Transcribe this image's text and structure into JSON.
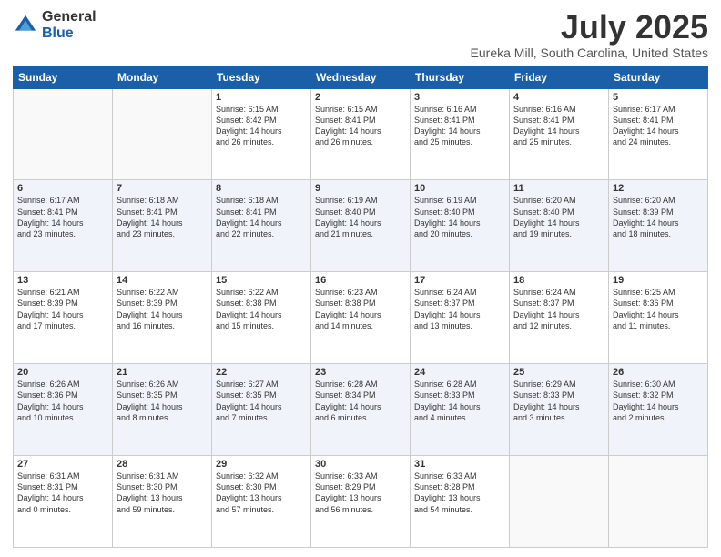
{
  "header": {
    "logo_general": "General",
    "logo_blue": "Blue",
    "title": "July 2025",
    "subtitle": "Eureka Mill, South Carolina, United States"
  },
  "calendar": {
    "days_of_week": [
      "Sunday",
      "Monday",
      "Tuesday",
      "Wednesday",
      "Thursday",
      "Friday",
      "Saturday"
    ],
    "weeks": [
      [
        {
          "day": "",
          "info": ""
        },
        {
          "day": "",
          "info": ""
        },
        {
          "day": "1",
          "info": "Sunrise: 6:15 AM\nSunset: 8:42 PM\nDaylight: 14 hours\nand 26 minutes."
        },
        {
          "day": "2",
          "info": "Sunrise: 6:15 AM\nSunset: 8:41 PM\nDaylight: 14 hours\nand 26 minutes."
        },
        {
          "day": "3",
          "info": "Sunrise: 6:16 AM\nSunset: 8:41 PM\nDaylight: 14 hours\nand 25 minutes."
        },
        {
          "day": "4",
          "info": "Sunrise: 6:16 AM\nSunset: 8:41 PM\nDaylight: 14 hours\nand 25 minutes."
        },
        {
          "day": "5",
          "info": "Sunrise: 6:17 AM\nSunset: 8:41 PM\nDaylight: 14 hours\nand 24 minutes."
        }
      ],
      [
        {
          "day": "6",
          "info": "Sunrise: 6:17 AM\nSunset: 8:41 PM\nDaylight: 14 hours\nand 23 minutes."
        },
        {
          "day": "7",
          "info": "Sunrise: 6:18 AM\nSunset: 8:41 PM\nDaylight: 14 hours\nand 23 minutes."
        },
        {
          "day": "8",
          "info": "Sunrise: 6:18 AM\nSunset: 8:41 PM\nDaylight: 14 hours\nand 22 minutes."
        },
        {
          "day": "9",
          "info": "Sunrise: 6:19 AM\nSunset: 8:40 PM\nDaylight: 14 hours\nand 21 minutes."
        },
        {
          "day": "10",
          "info": "Sunrise: 6:19 AM\nSunset: 8:40 PM\nDaylight: 14 hours\nand 20 minutes."
        },
        {
          "day": "11",
          "info": "Sunrise: 6:20 AM\nSunset: 8:40 PM\nDaylight: 14 hours\nand 19 minutes."
        },
        {
          "day": "12",
          "info": "Sunrise: 6:20 AM\nSunset: 8:39 PM\nDaylight: 14 hours\nand 18 minutes."
        }
      ],
      [
        {
          "day": "13",
          "info": "Sunrise: 6:21 AM\nSunset: 8:39 PM\nDaylight: 14 hours\nand 17 minutes."
        },
        {
          "day": "14",
          "info": "Sunrise: 6:22 AM\nSunset: 8:39 PM\nDaylight: 14 hours\nand 16 minutes."
        },
        {
          "day": "15",
          "info": "Sunrise: 6:22 AM\nSunset: 8:38 PM\nDaylight: 14 hours\nand 15 minutes."
        },
        {
          "day": "16",
          "info": "Sunrise: 6:23 AM\nSunset: 8:38 PM\nDaylight: 14 hours\nand 14 minutes."
        },
        {
          "day": "17",
          "info": "Sunrise: 6:24 AM\nSunset: 8:37 PM\nDaylight: 14 hours\nand 13 minutes."
        },
        {
          "day": "18",
          "info": "Sunrise: 6:24 AM\nSunset: 8:37 PM\nDaylight: 14 hours\nand 12 minutes."
        },
        {
          "day": "19",
          "info": "Sunrise: 6:25 AM\nSunset: 8:36 PM\nDaylight: 14 hours\nand 11 minutes."
        }
      ],
      [
        {
          "day": "20",
          "info": "Sunrise: 6:26 AM\nSunset: 8:36 PM\nDaylight: 14 hours\nand 10 minutes."
        },
        {
          "day": "21",
          "info": "Sunrise: 6:26 AM\nSunset: 8:35 PM\nDaylight: 14 hours\nand 8 minutes."
        },
        {
          "day": "22",
          "info": "Sunrise: 6:27 AM\nSunset: 8:35 PM\nDaylight: 14 hours\nand 7 minutes."
        },
        {
          "day": "23",
          "info": "Sunrise: 6:28 AM\nSunset: 8:34 PM\nDaylight: 14 hours\nand 6 minutes."
        },
        {
          "day": "24",
          "info": "Sunrise: 6:28 AM\nSunset: 8:33 PM\nDaylight: 14 hours\nand 4 minutes."
        },
        {
          "day": "25",
          "info": "Sunrise: 6:29 AM\nSunset: 8:33 PM\nDaylight: 14 hours\nand 3 minutes."
        },
        {
          "day": "26",
          "info": "Sunrise: 6:30 AM\nSunset: 8:32 PM\nDaylight: 14 hours\nand 2 minutes."
        }
      ],
      [
        {
          "day": "27",
          "info": "Sunrise: 6:31 AM\nSunset: 8:31 PM\nDaylight: 14 hours\nand 0 minutes."
        },
        {
          "day": "28",
          "info": "Sunrise: 6:31 AM\nSunset: 8:30 PM\nDaylight: 13 hours\nand 59 minutes."
        },
        {
          "day": "29",
          "info": "Sunrise: 6:32 AM\nSunset: 8:30 PM\nDaylight: 13 hours\nand 57 minutes."
        },
        {
          "day": "30",
          "info": "Sunrise: 6:33 AM\nSunset: 8:29 PM\nDaylight: 13 hours\nand 56 minutes."
        },
        {
          "day": "31",
          "info": "Sunrise: 6:33 AM\nSunset: 8:28 PM\nDaylight: 13 hours\nand 54 minutes."
        },
        {
          "day": "",
          "info": ""
        },
        {
          "day": "",
          "info": ""
        }
      ]
    ]
  }
}
